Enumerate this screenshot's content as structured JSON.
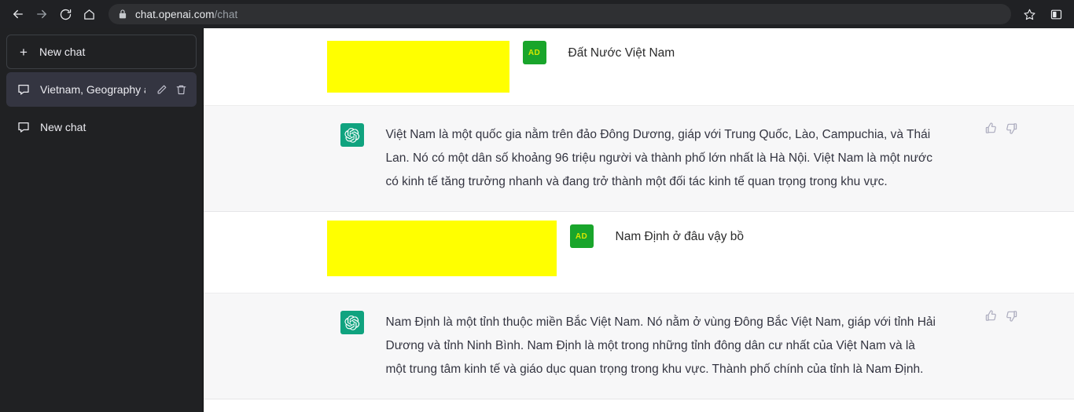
{
  "browser": {
    "back_label": "back-arrow",
    "forward_label": "forward-arrow",
    "reload_label": "reload",
    "home_label": "home",
    "lock_label": "lock",
    "url_domain": "chat.openai.com",
    "url_path": "/chat",
    "bookmark_label": "star",
    "panel_label": "side-panel"
  },
  "sidebar": {
    "new_chat_label": "New chat",
    "plus_glyph": "+",
    "items": [
      {
        "label": "Vietnam, Geography an",
        "active": true,
        "edit_label": "Rename chat",
        "delete_label": "Delete chat"
      },
      {
        "label": "New chat",
        "active": false,
        "edit_label": "",
        "delete_label": ""
      }
    ]
  },
  "colors": {
    "sidebar_bg": "#202123",
    "sidebar_active": "#343541",
    "assistant_bg": "#f7f7f8",
    "user_bg": "#ffffff",
    "highlight": "#ffff00",
    "ad_avatar": "#19a52b",
    "gpt_avatar": "#10a37f",
    "browser_bg": "#202124"
  },
  "conversation": {
    "messages": [
      {
        "role": "user",
        "avatar_label": "AD",
        "text": "Đất Nước Việt Nam",
        "highlighted": true
      },
      {
        "role": "assistant",
        "avatar_label": "openai-logo",
        "text": "Việt Nam là một quốc gia nằm trên đảo Đông Dương, giáp với Trung Quốc, Lào, Campuchia, và Thái Lan. Nó có một dân số khoảng 96 triệu người và thành phố lớn nhất là Hà Nội. Việt Nam là một nước có kinh tế tăng trưởng nhanh và đang trở thành một đối tác kinh tế quan trọng trong khu vực.",
        "highlighted": false,
        "thumbs_up_label": "Good response",
        "thumbs_down_label": "Bad response"
      },
      {
        "role": "user",
        "avatar_label": "AD",
        "text": "Nam Định ở đâu vậy bồ",
        "highlighted": true
      },
      {
        "role": "assistant",
        "avatar_label": "openai-logo",
        "text": "Nam Định là một tỉnh thuộc miền Bắc Việt Nam. Nó nằm ở vùng Đông Bắc Việt Nam, giáp với tỉnh Hải Dương và tỉnh Ninh Bình. Nam Định là một trong những tỉnh đông dân cư nhất của Việt Nam và là một trung tâm kinh tế và giáo dục quan trọng trong khu vực. Thành phố chính của tỉnh là Nam Định.",
        "highlighted": false,
        "thumbs_up_label": "Good response",
        "thumbs_down_label": "Bad response"
      }
    ]
  }
}
